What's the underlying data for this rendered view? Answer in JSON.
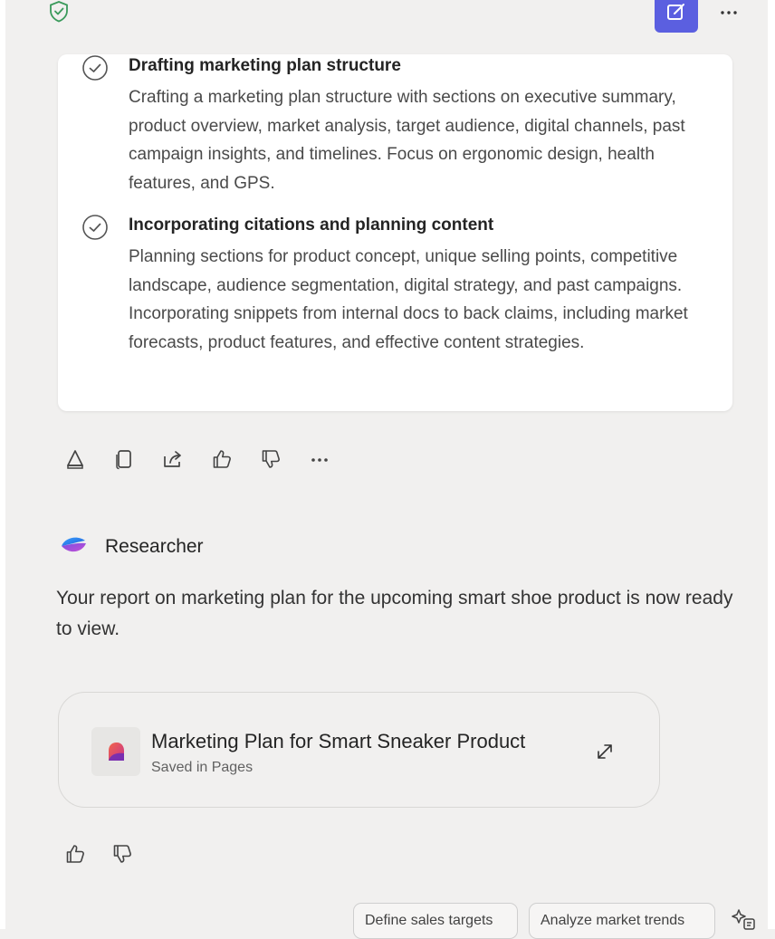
{
  "top_bar": {
    "shield_icon": "shield-check-icon",
    "compose_icon": "compose-icon",
    "more_icon": "more-horizontal-icon",
    "accent_color": "#5b5fe0"
  },
  "reasoning": {
    "steps": [
      {
        "title": "Drafting marketing plan structure",
        "body": "Crafting a marketing plan structure with sections on executive summary, product overview, market analysis, target audience, digital channels, past campaign insights, and timelines. Focus on ergonomic design, health features, and GPS."
      },
      {
        "title": "Incorporating citations and planning content",
        "body": "Planning sections for product concept, unique selling points, competitive landscape, audience segmentation, digital strategy, and past campaigns. Incorporating snippets from internal docs to back claims, including market forecasts, product features, and effective content strategies."
      }
    ]
  },
  "message_actions": [
    "pages-icon",
    "copy-icon",
    "share-icon",
    "thumbs-up-icon",
    "thumbs-down-icon",
    "more-horizontal-icon"
  ],
  "researcher": {
    "name": "Researcher",
    "message": "Your report on marketing plan for the upcoming smart shoe product is now ready to view."
  },
  "page_card": {
    "title": "Marketing Plan for Smart Sneaker Product",
    "subtitle": "Saved in Pages"
  },
  "suggestions": [
    "Define sales targets",
    "Analyze market trends"
  ]
}
